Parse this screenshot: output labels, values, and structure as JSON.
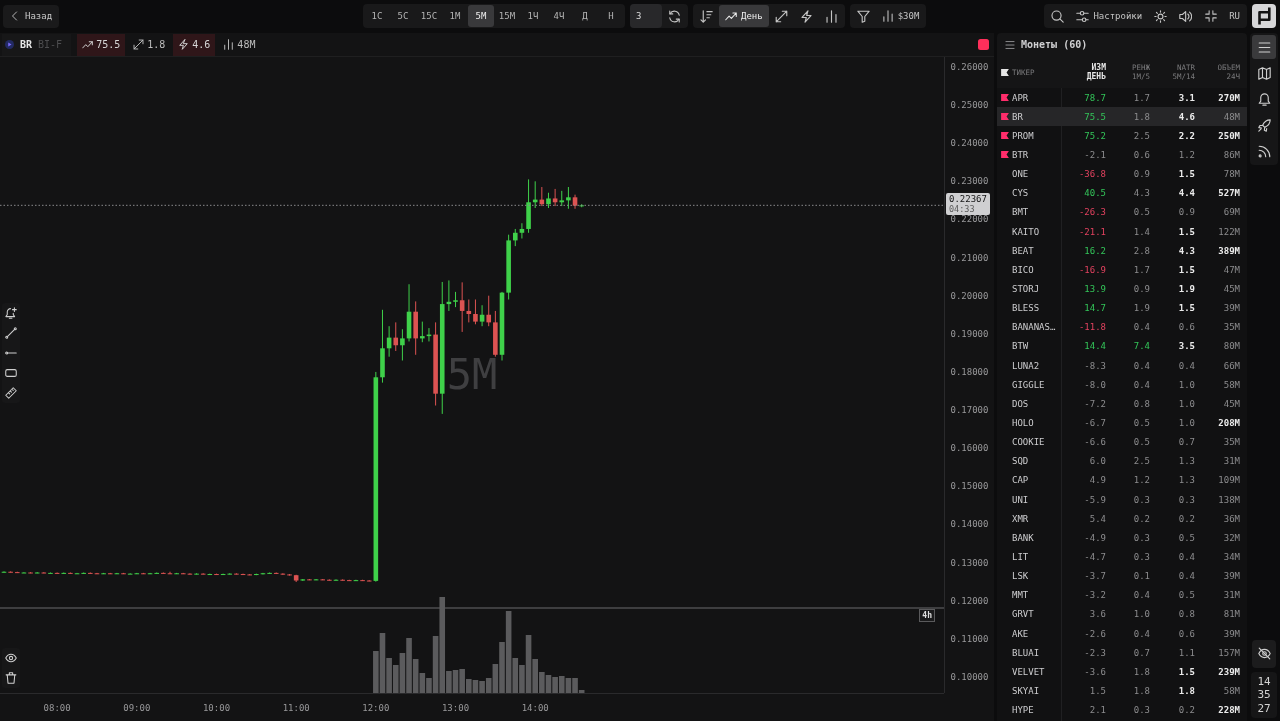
{
  "top_bar": {
    "back_button": {
      "label": "Назад"
    },
    "timeframes": [
      {
        "label": "1С",
        "selected": false
      },
      {
        "label": "5С",
        "selected": false
      },
      {
        "label": "15С",
        "selected": false
      },
      {
        "label": "1М",
        "selected": false
      },
      {
        "label": "5М",
        "selected": true
      },
      {
        "label": "15М",
        "selected": false
      },
      {
        "label": "1Ч",
        "selected": false
      },
      {
        "label": "4Ч",
        "selected": false
      },
      {
        "label": "Д",
        "selected": false
      },
      {
        "label": "Н",
        "selected": false
      }
    ],
    "chart_count": {
      "value": "3"
    },
    "view_modes": [
      {
        "kind": "sort",
        "selected": false
      },
      {
        "kind": "change",
        "label": "День",
        "selected": true
      },
      {
        "kind": "range",
        "selected": false
      },
      {
        "kind": "natr",
        "selected": false
      },
      {
        "kind": "volume",
        "selected": false
      }
    ],
    "volume_filter": {
      "label": "$30M"
    },
    "settings_button": {
      "label": "Настройки"
    },
    "language_button": {
      "label": "RU"
    }
  },
  "chart": {
    "symbol": "BR",
    "exchange": "BI-F",
    "metrics": [
      {
        "kind": "change",
        "value": "75.5",
        "highlight": true
      },
      {
        "kind": "range",
        "value": "1.8",
        "highlight": false
      },
      {
        "kind": "natr",
        "value": "4.6",
        "highlight": true
      },
      {
        "kind": "volume",
        "value": "48M",
        "highlight": false
      }
    ],
    "watermark": "5М",
    "pane_label": "4h",
    "price_axis": [
      "0.26000",
      "0.25000",
      "0.24000",
      "0.23000",
      "0.22000",
      "0.21000",
      "0.20000",
      "0.19000",
      "0.18000",
      "0.17000",
      "0.16000",
      "0.15000",
      "0.14000",
      "0.13000",
      "0.12000",
      "0.11000",
      "0.10000"
    ],
    "time_axis": [
      "08:00",
      "09:00",
      "10:00",
      "11:00",
      "12:00",
      "13:00",
      "14:00"
    ],
    "last_price": {
      "value": "0.22367",
      "countdown": "04:33"
    }
  },
  "coins_panel": {
    "title": "Монеты (60)",
    "columns": [
      {
        "label": "ТИКЕР",
        "selected": false
      },
      {
        "label": "ИЗМ",
        "sublabel": "ДЕНЬ",
        "selected": true
      },
      {
        "label": "РЕНЖ",
        "sublabel": "1М/5",
        "selected": false
      },
      {
        "label": "NATR",
        "sublabel": "5М/14",
        "selected": false
      },
      {
        "label": "ОБЪЕМ",
        "sublabel": "24Ч",
        "selected": false
      }
    ],
    "rows": [
      {
        "ticker": "APR",
        "flagged": true,
        "selected": false,
        "change": "78.7",
        "change_up": true,
        "change_down": false,
        "range": "1.7",
        "range_up": false,
        "natr": "3.1",
        "natr_strong": true,
        "volume": "270M",
        "volume_strong": true
      },
      {
        "ticker": "BR",
        "flagged": true,
        "selected": true,
        "change": "75.5",
        "change_up": true,
        "change_down": false,
        "range": "1.8",
        "range_up": false,
        "natr": "4.6",
        "natr_strong": true,
        "volume": "48M",
        "volume_strong": false
      },
      {
        "ticker": "PROM",
        "flagged": true,
        "selected": false,
        "change": "75.2",
        "change_up": true,
        "change_down": false,
        "range": "2.5",
        "range_up": false,
        "natr": "2.2",
        "natr_strong": true,
        "volume": "250M",
        "volume_strong": true
      },
      {
        "ticker": "BTR",
        "flagged": true,
        "selected": false,
        "change": "-2.1",
        "change_up": false,
        "change_down": false,
        "range": "0.6",
        "range_up": false,
        "natr": "1.2",
        "natr_strong": false,
        "volume": "86M",
        "volume_strong": false
      },
      {
        "ticker": "ONE",
        "flagged": false,
        "selected": false,
        "change": "-36.8",
        "change_up": false,
        "change_down": true,
        "range": "0.9",
        "range_up": false,
        "natr": "1.5",
        "natr_strong": true,
        "volume": "78M",
        "volume_strong": false
      },
      {
        "ticker": "CYS",
        "flagged": false,
        "selected": false,
        "change": "40.5",
        "change_up": true,
        "change_down": false,
        "range": "4.3",
        "range_up": false,
        "natr": "4.4",
        "natr_strong": true,
        "volume": "527M",
        "volume_strong": true
      },
      {
        "ticker": "BMT",
        "flagged": false,
        "selected": false,
        "change": "-26.3",
        "change_up": false,
        "change_down": true,
        "range": "0.5",
        "range_up": false,
        "natr": "0.9",
        "natr_strong": false,
        "volume": "69M",
        "volume_strong": false
      },
      {
        "ticker": "KAITO",
        "flagged": false,
        "selected": false,
        "change": "-21.1",
        "change_up": false,
        "change_down": true,
        "range": "1.4",
        "range_up": false,
        "natr": "1.5",
        "natr_strong": true,
        "volume": "122M",
        "volume_strong": false
      },
      {
        "ticker": "BEAT",
        "flagged": false,
        "selected": false,
        "change": "16.2",
        "change_up": true,
        "change_down": false,
        "range": "2.8",
        "range_up": false,
        "natr": "4.3",
        "natr_strong": true,
        "volume": "389M",
        "volume_strong": true
      },
      {
        "ticker": "BICO",
        "flagged": false,
        "selected": false,
        "change": "-16.9",
        "change_up": false,
        "change_down": true,
        "range": "1.7",
        "range_up": false,
        "natr": "1.5",
        "natr_strong": true,
        "volume": "47M",
        "volume_strong": false
      },
      {
        "ticker": "STORJ",
        "flagged": false,
        "selected": false,
        "change": "13.9",
        "change_up": true,
        "change_down": false,
        "range": "0.9",
        "range_up": false,
        "natr": "1.9",
        "natr_strong": true,
        "volume": "45M",
        "volume_strong": false
      },
      {
        "ticker": "BLESS",
        "flagged": false,
        "selected": false,
        "change": "14.7",
        "change_up": true,
        "change_down": false,
        "range": "1.9",
        "range_up": false,
        "natr": "1.5",
        "natr_strong": true,
        "volume": "39M",
        "volume_strong": false
      },
      {
        "ticker": "BANANAS…",
        "flagged": false,
        "selected": false,
        "change": "-11.8",
        "change_up": false,
        "change_down": true,
        "range": "0.4",
        "range_up": false,
        "natr": "0.6",
        "natr_strong": false,
        "volume": "35M",
        "volume_strong": false
      },
      {
        "ticker": "BTW",
        "flagged": false,
        "selected": false,
        "change": "14.4",
        "change_up": true,
        "change_down": false,
        "range": "7.4",
        "range_up": true,
        "natr": "3.5",
        "natr_strong": true,
        "volume": "80M",
        "volume_strong": false
      },
      {
        "ticker": "LUNA2",
        "flagged": false,
        "selected": false,
        "change": "-8.3",
        "change_up": false,
        "change_down": false,
        "range": "0.4",
        "range_up": false,
        "natr": "0.4",
        "natr_strong": false,
        "volume": "66M",
        "volume_strong": false
      },
      {
        "ticker": "GIGGLE",
        "flagged": false,
        "selected": false,
        "change": "-8.0",
        "change_up": false,
        "change_down": false,
        "range": "0.4",
        "range_up": false,
        "natr": "1.0",
        "natr_strong": false,
        "volume": "58M",
        "volume_strong": false
      },
      {
        "ticker": "DOS",
        "flagged": false,
        "selected": false,
        "change": "-7.2",
        "change_up": false,
        "change_down": false,
        "range": "0.8",
        "range_up": false,
        "natr": "1.0",
        "natr_strong": false,
        "volume": "45M",
        "volume_strong": false
      },
      {
        "ticker": "HOLO",
        "flagged": false,
        "selected": false,
        "change": "-6.7",
        "change_up": false,
        "change_down": false,
        "range": "0.5",
        "range_up": false,
        "natr": "1.0",
        "natr_strong": false,
        "volume": "208M",
        "volume_strong": true
      },
      {
        "ticker": "COOKIE",
        "flagged": false,
        "selected": false,
        "change": "-6.6",
        "change_up": false,
        "change_down": false,
        "range": "0.5",
        "range_up": false,
        "natr": "0.7",
        "natr_strong": false,
        "volume": "35M",
        "volume_strong": false
      },
      {
        "ticker": "SQD",
        "flagged": false,
        "selected": false,
        "change": "6.0",
        "change_up": false,
        "change_down": false,
        "range": "2.5",
        "range_up": false,
        "natr": "1.3",
        "natr_strong": false,
        "volume": "31M",
        "volume_strong": false
      },
      {
        "ticker": "CAP",
        "flagged": false,
        "selected": false,
        "change": "4.9",
        "change_up": false,
        "change_down": false,
        "range": "1.2",
        "range_up": false,
        "natr": "1.3",
        "natr_strong": false,
        "volume": "109M",
        "volume_strong": false
      },
      {
        "ticker": "UNI",
        "flagged": false,
        "selected": false,
        "change": "-5.9",
        "change_up": false,
        "change_down": false,
        "range": "0.3",
        "range_up": false,
        "natr": "0.3",
        "natr_strong": false,
        "volume": "138M",
        "volume_strong": false
      },
      {
        "ticker": "XMR",
        "flagged": false,
        "selected": false,
        "change": "5.4",
        "change_up": false,
        "change_down": false,
        "range": "0.2",
        "range_up": false,
        "natr": "0.2",
        "natr_strong": false,
        "volume": "36M",
        "volume_strong": false
      },
      {
        "ticker": "BANK",
        "flagged": false,
        "selected": false,
        "change": "-4.9",
        "change_up": false,
        "change_down": false,
        "range": "0.3",
        "range_up": false,
        "natr": "0.5",
        "natr_strong": false,
        "volume": "32M",
        "volume_strong": false
      },
      {
        "ticker": "LIT",
        "flagged": false,
        "selected": false,
        "change": "-4.7",
        "change_up": false,
        "change_down": false,
        "range": "0.3",
        "range_up": false,
        "natr": "0.4",
        "natr_strong": false,
        "volume": "34M",
        "volume_strong": false
      },
      {
        "ticker": "LSK",
        "flagged": false,
        "selected": false,
        "change": "-3.7",
        "change_up": false,
        "change_down": false,
        "range": "0.1",
        "range_up": false,
        "natr": "0.4",
        "natr_strong": false,
        "volume": "39M",
        "volume_strong": false
      },
      {
        "ticker": "MMT",
        "flagged": false,
        "selected": false,
        "change": "-3.2",
        "change_up": false,
        "change_down": false,
        "range": "0.4",
        "range_up": false,
        "natr": "0.5",
        "natr_strong": false,
        "volume": "31M",
        "volume_strong": false
      },
      {
        "ticker": "GRVT",
        "flagged": false,
        "selected": false,
        "change": "3.6",
        "change_up": false,
        "change_down": false,
        "range": "1.0",
        "range_up": false,
        "natr": "0.8",
        "natr_strong": false,
        "volume": "81M",
        "volume_strong": false
      },
      {
        "ticker": "AKE",
        "flagged": false,
        "selected": false,
        "change": "-2.6",
        "change_up": false,
        "change_down": false,
        "range": "0.4",
        "range_up": false,
        "natr": "0.6",
        "natr_strong": false,
        "volume": "39M",
        "volume_strong": false
      },
      {
        "ticker": "BLUAI",
        "flagged": false,
        "selected": false,
        "change": "-2.3",
        "change_up": false,
        "change_down": false,
        "range": "0.7",
        "range_up": false,
        "natr": "1.1",
        "natr_strong": false,
        "volume": "157M",
        "volume_strong": false
      },
      {
        "ticker": "VELVET",
        "flagged": false,
        "selected": false,
        "change": "-3.6",
        "change_up": false,
        "change_down": false,
        "range": "1.8",
        "range_up": false,
        "natr": "1.5",
        "natr_strong": true,
        "volume": "239M",
        "volume_strong": true
      },
      {
        "ticker": "SKYAI",
        "flagged": false,
        "selected": false,
        "change": "1.5",
        "change_up": false,
        "change_down": false,
        "range": "1.8",
        "range_up": false,
        "natr": "1.8",
        "natr_strong": true,
        "volume": "58M",
        "volume_strong": false
      },
      {
        "ticker": "HYPE",
        "flagged": false,
        "selected": false,
        "change": "2.1",
        "change_up": false,
        "change_down": false,
        "range": "0.3",
        "range_up": false,
        "natr": "0.2",
        "natr_strong": false,
        "volume": "228M",
        "volume_strong": true
      }
    ]
  },
  "side_rail": {
    "items": [
      {
        "kind": "list",
        "selected": true
      },
      {
        "kind": "map",
        "selected": false
      },
      {
        "kind": "alerts",
        "selected": false
      },
      {
        "kind": "launch",
        "selected": false
      },
      {
        "kind": "feed",
        "selected": false
      }
    ],
    "clock": [
      "14",
      "35",
      "27"
    ]
  }
}
